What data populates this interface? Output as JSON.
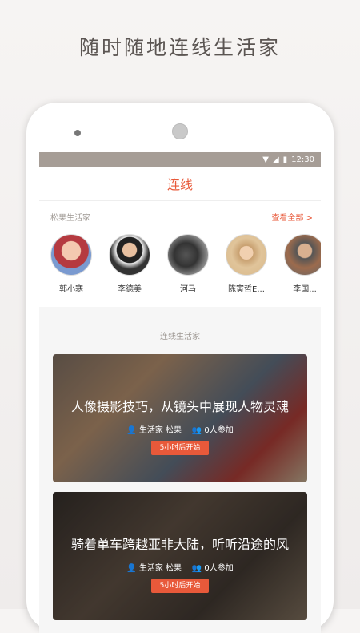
{
  "headline": "随时随地连线生活家",
  "status": {
    "time": "12:30"
  },
  "appbar": {
    "title": "连线"
  },
  "section": {
    "title": "松果生活家",
    "view_all": "查看全部 >",
    "people": [
      {
        "name": "郭小寒"
      },
      {
        "name": "李德美"
      },
      {
        "name": "河马"
      },
      {
        "name": "陈寅哲E..."
      },
      {
        "name": "李国..."
      }
    ]
  },
  "subheading": "连线生活家",
  "cards": [
    {
      "title": "人像摄影技巧，从镜头中展现人物灵魂",
      "host": "生活家 松果",
      "participants": "0人参加",
      "button": "5小时后开始"
    },
    {
      "title": "骑着单车跨越亚非大陆，听听沿途的风",
      "host": "生活家 松果",
      "participants": "0人参加",
      "button": "5小时后开始"
    }
  ]
}
